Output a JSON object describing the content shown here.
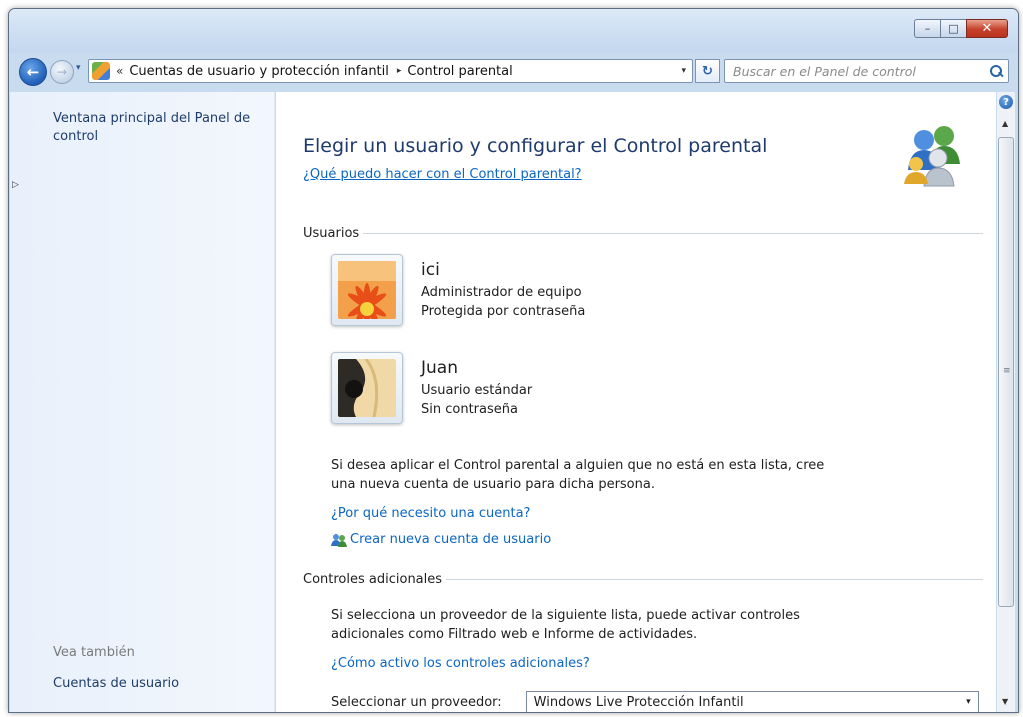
{
  "window": {
    "caption_buttons": {
      "minimize": "–",
      "maximize": "□",
      "close": "✕"
    }
  },
  "nav": {
    "back_glyph": "←",
    "forward_glyph": "→",
    "recent_glyph": "▾"
  },
  "address": {
    "chevrons": "«",
    "segments": [
      "Cuentas de usuario y protección infantil",
      "Control parental"
    ],
    "separator": "▸",
    "dropdown_glyph": "▾"
  },
  "refresh_glyph": "↻",
  "search": {
    "placeholder": "Buscar en el Panel de control"
  },
  "sidebar": {
    "home_link": "Ventana principal del Panel de control",
    "pane_arrow": "▷",
    "see_also": "Vea también",
    "see_links": [
      "Cuentas de usuario"
    ]
  },
  "main": {
    "title": "Elegir un usuario y configurar el Control parental",
    "help_link": "¿Qué puedo hacer con el Control parental?",
    "users_header": "Usuarios",
    "users": [
      {
        "name": "ici",
        "type": "Administrador de equipo",
        "password": "Protegida por contraseña"
      },
      {
        "name": "Juan",
        "type": "Usuario estándar",
        "password": "Sin contraseña"
      }
    ],
    "note": "Si desea aplicar el Control parental a alguien que no está en esta lista, cree una nueva cuenta de usuario para dicha persona.",
    "why_account_link": "¿Por qué necesito una cuenta?",
    "create_account_link": "Crear nueva cuenta de usuario",
    "additional_header": "Controles adicionales",
    "additional_text": "Si selecciona un proveedor de la siguiente lista, puede activar controles adicionales como Filtrado web e Informe de actividades.",
    "additional_link": "¿Cómo activo los controles adicionales?",
    "provider_label": "Seleccionar un proveedor:",
    "provider_value": "Windows Live Protección Infantil",
    "provider_drop": "▾"
  },
  "scrollbar": {
    "help": "?",
    "up": "▲",
    "grip": "≡",
    "down": "▼"
  }
}
